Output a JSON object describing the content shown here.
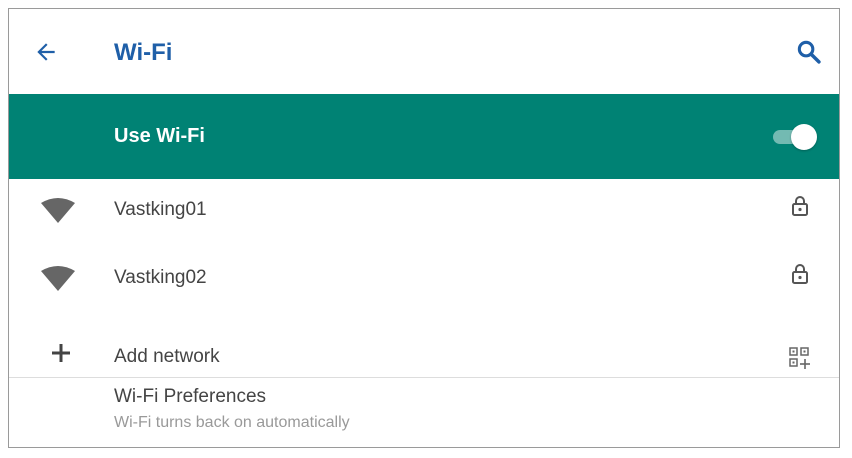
{
  "app_bar": {
    "title": "Wi-Fi",
    "back_icon": "arrow-back-icon",
    "search_icon": "search-icon",
    "accent_color": "#1f5fa8"
  },
  "wifi_toggle": {
    "label": "Use Wi-Fi",
    "state": "on",
    "background_color": "#008274"
  },
  "networks": [
    {
      "name": "Vastking01",
      "signal_icon": "wifi-signal-icon",
      "secured": true,
      "lock_icon": "lock-icon"
    },
    {
      "name": "Vastking02",
      "signal_icon": "wifi-signal-icon",
      "secured": true,
      "lock_icon": "lock-icon"
    }
  ],
  "add_network": {
    "label": "Add network",
    "icon": "plus-icon",
    "qr_icon": "qr-code-scan-icon"
  },
  "preferences": {
    "title": "Wi-Fi Preferences",
    "subtitle": "Wi-Fi turns back on automatically"
  }
}
